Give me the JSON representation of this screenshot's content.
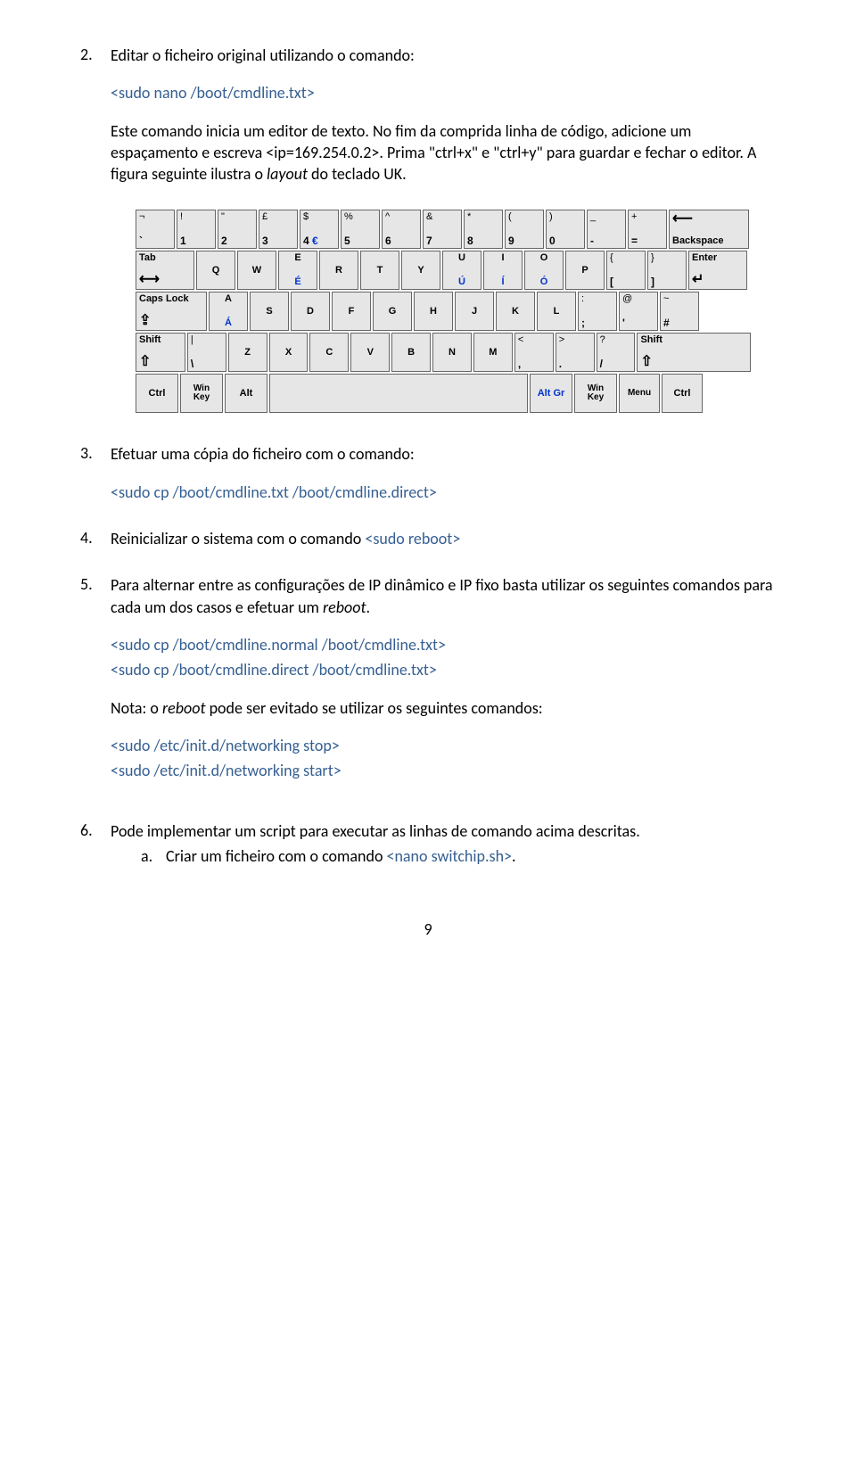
{
  "li2": {
    "marker": "2.",
    "p1": "Editar o ficheiro original utilizando o comando:",
    "cmd1": "<sudo nano /boot/cmdline.txt>",
    "p2a": "Este comando inicia um editor de texto. No fim da comprida linha de código, adicione um espaçamento e escreva <ip=169.254.0.2>. Prima \"ctrl+x\" e \"ctrl+y\" para guardar e fechar o editor. A figura seguinte ilustra o ",
    "p2b": "layout",
    "p2c": " do teclado UK."
  },
  "kb": {
    "r1": [
      {
        "top": "¬",
        "bot": "`"
      },
      {
        "top": "!",
        "bot": "1"
      },
      {
        "top": "\"",
        "bot": "2"
      },
      {
        "top": "£",
        "bot": "3"
      },
      {
        "top": "$",
        "bot": "4",
        "extra": "€"
      },
      {
        "top": "%",
        "bot": "5"
      },
      {
        "top": "^",
        "bot": "6"
      },
      {
        "top": "&",
        "bot": "7"
      },
      {
        "top": "*",
        "bot": "8"
      },
      {
        "top": "(",
        "bot": "9"
      },
      {
        "top": ")",
        "bot": "0"
      },
      {
        "top": "_",
        "bot": "-"
      },
      {
        "top": "+",
        "bot": "="
      }
    ],
    "bksp": "Backspace",
    "tab": "Tab",
    "r2": [
      "Q",
      "W",
      "E",
      "R",
      "T",
      "Y",
      "U",
      "I",
      "O",
      "P"
    ],
    "r2accents": {
      "E": "É",
      "U": "Ú",
      "I": "Í",
      "O": "Ó"
    },
    "r2b": [
      {
        "top": "{",
        "bot": "["
      },
      {
        "top": "}",
        "bot": "]"
      }
    ],
    "enter": "Enter",
    "caps": "Caps Lock",
    "r3": [
      "A",
      "S",
      "D",
      "F",
      "G",
      "H",
      "J",
      "K",
      "L"
    ],
    "r3accents": {
      "A": "Á"
    },
    "r3b": [
      {
        "top": ":",
        "bot": ";"
      },
      {
        "top": "@",
        "bot": "'"
      },
      {
        "top": "~",
        "bot": "#"
      }
    ],
    "shift": "Shift",
    "r4a": {
      "top": "|",
      "bot": "\\"
    },
    "r4": [
      "Z",
      "X",
      "C",
      "V",
      "B",
      "N",
      "M"
    ],
    "r4b": [
      {
        "top": "<",
        "bot": ","
      },
      {
        "top": ">",
        "bot": "."
      },
      {
        "top": "?",
        "bot": "/"
      }
    ],
    "r5": {
      "ctrl": "Ctrl",
      "win": "Win\nKey",
      "alt": "Alt",
      "altgr": "Alt Gr",
      "menu": "Menu"
    }
  },
  "li3": {
    "marker": "3.",
    "p1": "Efetuar uma cópia do ficheiro com o comando:",
    "cmd1": "<sudo cp /boot/cmdline.txt /boot/cmdline.direct>"
  },
  "li4": {
    "marker": "4.",
    "p1a": "Reinicializar o sistema com o comando ",
    "p1b": "<sudo reboot>"
  },
  "li5": {
    "marker": "5.",
    "p1a": "Para alternar entre as configurações de IP dinâmico e IP fixo basta utilizar os seguintes comandos para cada um dos casos e efetuar um ",
    "p1b": "reboot",
    "p1c": ".",
    "cmd1": "<sudo cp /boot/cmdline.normal /boot/cmdline.txt>",
    "cmd2": "<sudo cp /boot/cmdline.direct /boot/cmdline.txt>",
    "note1a": "Nota: o ",
    "note1b": "reboot",
    "note1c": " pode ser evitado se utilizar os seguintes comandos:",
    "cmd3": "<sudo /etc/init.d/networking stop>",
    "cmd4": "<sudo /etc/init.d/networking start>"
  },
  "li6": {
    "marker": "6.",
    "p1": "Pode implementar um script para executar as linhas de comando acima descritas.",
    "sub": {
      "marker": "a.",
      "text_a": "Criar um ficheiro com o comando ",
      "text_b": "<nano switchip.sh>",
      "text_c": "."
    }
  },
  "page_number": "9"
}
